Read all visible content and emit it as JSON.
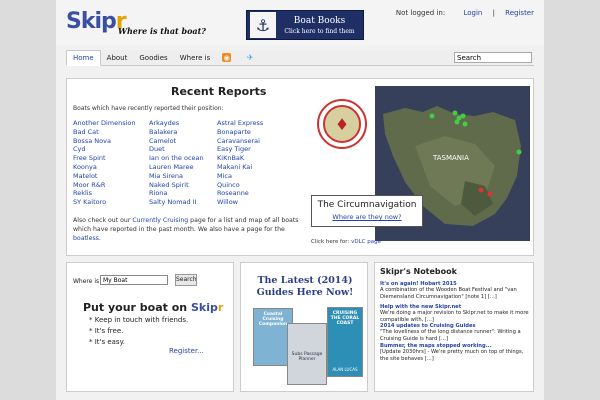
{
  "header": {
    "logo_main": "Skip",
    "logo_accent": "r",
    "tagline": "Where is that boat?",
    "banner_title": "Boat Books",
    "banner_sub": "Click here to find them",
    "login_status": "Not logged in:",
    "login": "Login",
    "register": "Register"
  },
  "nav": {
    "items": [
      "Home",
      "About",
      "Goodies",
      "Where is"
    ],
    "search_value": "Search"
  },
  "recent": {
    "title": "Recent Reports",
    "intro": "Boats which have recently reported their position:",
    "col1": [
      "Another Dimension",
      "Bad Cat",
      "Bossa Nova",
      "Cyd",
      "Free Spint",
      "Koonya",
      "Matelot",
      "Moor R&R",
      "Reklis",
      "SY Kaitoro"
    ],
    "col2": [
      "Arkaydes",
      "Balakera",
      "Camelot",
      "Duet",
      "Ian on the ocean",
      "Lauren Maree",
      "Mia Sirena",
      "Naked Spirit",
      "Riona",
      "Salty Nomad II"
    ],
    "col3": [
      "Astral Express",
      "Bonaparte",
      "Caravanserai",
      "Easy Tiger",
      "KiKnBaK",
      "Makani Kai",
      "Mica",
      "Quinco",
      "Roseanne",
      "Willow"
    ],
    "also_1": "Also check out our ",
    "also_link1": "Currently Cruising",
    "also_2": " page for a list and map of all boats which have reported in the past month. We also have a page for the ",
    "also_link2": "boatless",
    "also_3": ".",
    "map_label": "TASMANIA",
    "caption_title": "The Circumnavigation",
    "caption_link": "Where are they now?",
    "clickfor": "Click here for: ",
    "clickfor_link": "vDLC page"
  },
  "where": {
    "label": "Where is",
    "input_value": "My Boat",
    "button": "Search",
    "put_text": "Put your boat on ",
    "put_brand": "Skip",
    "put_brand_accent": "r",
    "bullets": [
      "* Keep in touch with friends.",
      "* It's free.",
      "* It's easy."
    ],
    "register": "Register..."
  },
  "guides": {
    "title": "The Latest (2014) Guides Here Now!",
    "book1": "Coastal Cruising Companion",
    "book2": "Subs Passage Planner",
    "book3": "CRUISING THE CORAL COAST",
    "book3_author": "ALAN LUCAS"
  },
  "notebook": {
    "title": "Skipr's Notebook",
    "entries": [
      {
        "h": "It's on again! Hobart 2015",
        "b": "A combination of the Wooden Boat Festival and \"van Diemensland Circumnavigation\" [note 1] [...]"
      },
      {
        "h": "Help with the new Skipr.net",
        "b": "We're doing a major revision to Skipr.net to make it more compatible with, [...]"
      },
      {
        "h": "2014 updates to Cruising Guides",
        "b": "\"The loveliness of the long distance runner\": Writing a Cruising Guide is hard [...]"
      },
      {
        "h": "Bummer, the maps stopped working...",
        "b": "[Update 2030hrs] - We're pretty much on top of things, the site behaves [...]"
      }
    ]
  },
  "colors": {
    "brand": "#3a4ea3",
    "accent": "#e2a400",
    "link": "#2244aa"
  }
}
